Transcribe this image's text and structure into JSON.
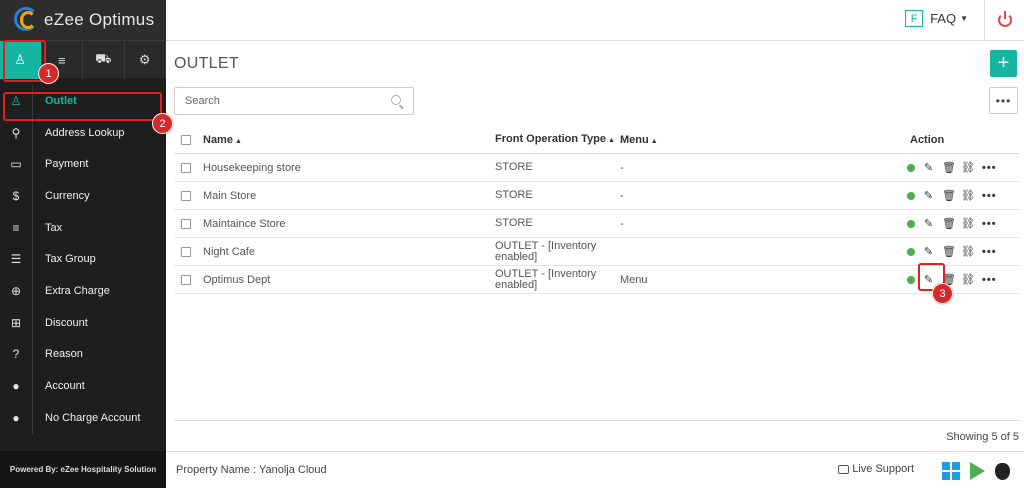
{
  "app": {
    "brand": "eZee Optimus"
  },
  "sidebar": {
    "tabs": [
      {
        "icon": "user-icon",
        "glyph": "♙"
      },
      {
        "icon": "list-icon",
        "glyph": "≡"
      },
      {
        "icon": "cart-icon",
        "glyph": "⛟"
      },
      {
        "icon": "gear-icon",
        "glyph": "⚙"
      }
    ],
    "items": [
      {
        "label": "Outlet",
        "icon": "user-outline-icon",
        "glyph": "♙"
      },
      {
        "label": "Address Lookup",
        "icon": "map-pin-icon",
        "glyph": "⚲"
      },
      {
        "label": "Payment",
        "icon": "credit-card-icon",
        "glyph": "▭"
      },
      {
        "label": "Currency",
        "icon": "dollar-icon",
        "glyph": "$"
      },
      {
        "label": "Tax",
        "icon": "bars-icon",
        "glyph": "≡"
      },
      {
        "label": "Tax Group",
        "icon": "list-icon",
        "glyph": "☰"
      },
      {
        "label": "Extra Charge",
        "icon": "plus-circle-icon",
        "glyph": "⊕"
      },
      {
        "label": "Discount",
        "icon": "gift-icon",
        "glyph": "⊞"
      },
      {
        "label": "Reason",
        "icon": "question-circle-icon",
        "glyph": "?"
      },
      {
        "label": "Account",
        "icon": "user-solid-icon",
        "glyph": "●"
      },
      {
        "label": "No Charge Account",
        "icon": "user-solid-icon",
        "glyph": "●"
      }
    ],
    "footer": "Powered By: eZee Hospitality Solution"
  },
  "topbar": {
    "faq_badge": "F",
    "faq_label": "FAQ"
  },
  "main": {
    "title": "OUTLET",
    "add_label": "+",
    "search": {
      "placeholder": "Search",
      "value": ""
    },
    "more_label": "•••",
    "columns": {
      "name": "Name",
      "type": "Front Operation Type",
      "menu": "Menu",
      "action": "Action"
    },
    "rows": [
      {
        "name": "Housekeeping store",
        "type": "STORE",
        "menu": "-"
      },
      {
        "name": "Main Store",
        "type": "STORE",
        "menu": "-"
      },
      {
        "name": "Maintaince Store",
        "type": "STORE",
        "menu": "-"
      },
      {
        "name": "Night Cafe",
        "type": "OUTLET - [Inventory enabled]",
        "menu": ""
      },
      {
        "name": "Optimus Dept",
        "type": "OUTLET - [Inventory enabled]",
        "menu": "Menu"
      }
    ],
    "showing": "Showing 5 of 5"
  },
  "footer": {
    "property": "Property Name : Yanolja Cloud",
    "support": "Live Support"
  },
  "annotations": [
    "1",
    "2",
    "3"
  ],
  "colors": {
    "accent": "#16b5a0",
    "annotation": "#e02020",
    "status_active": "#4cae4c",
    "power": "#e34b4b"
  }
}
